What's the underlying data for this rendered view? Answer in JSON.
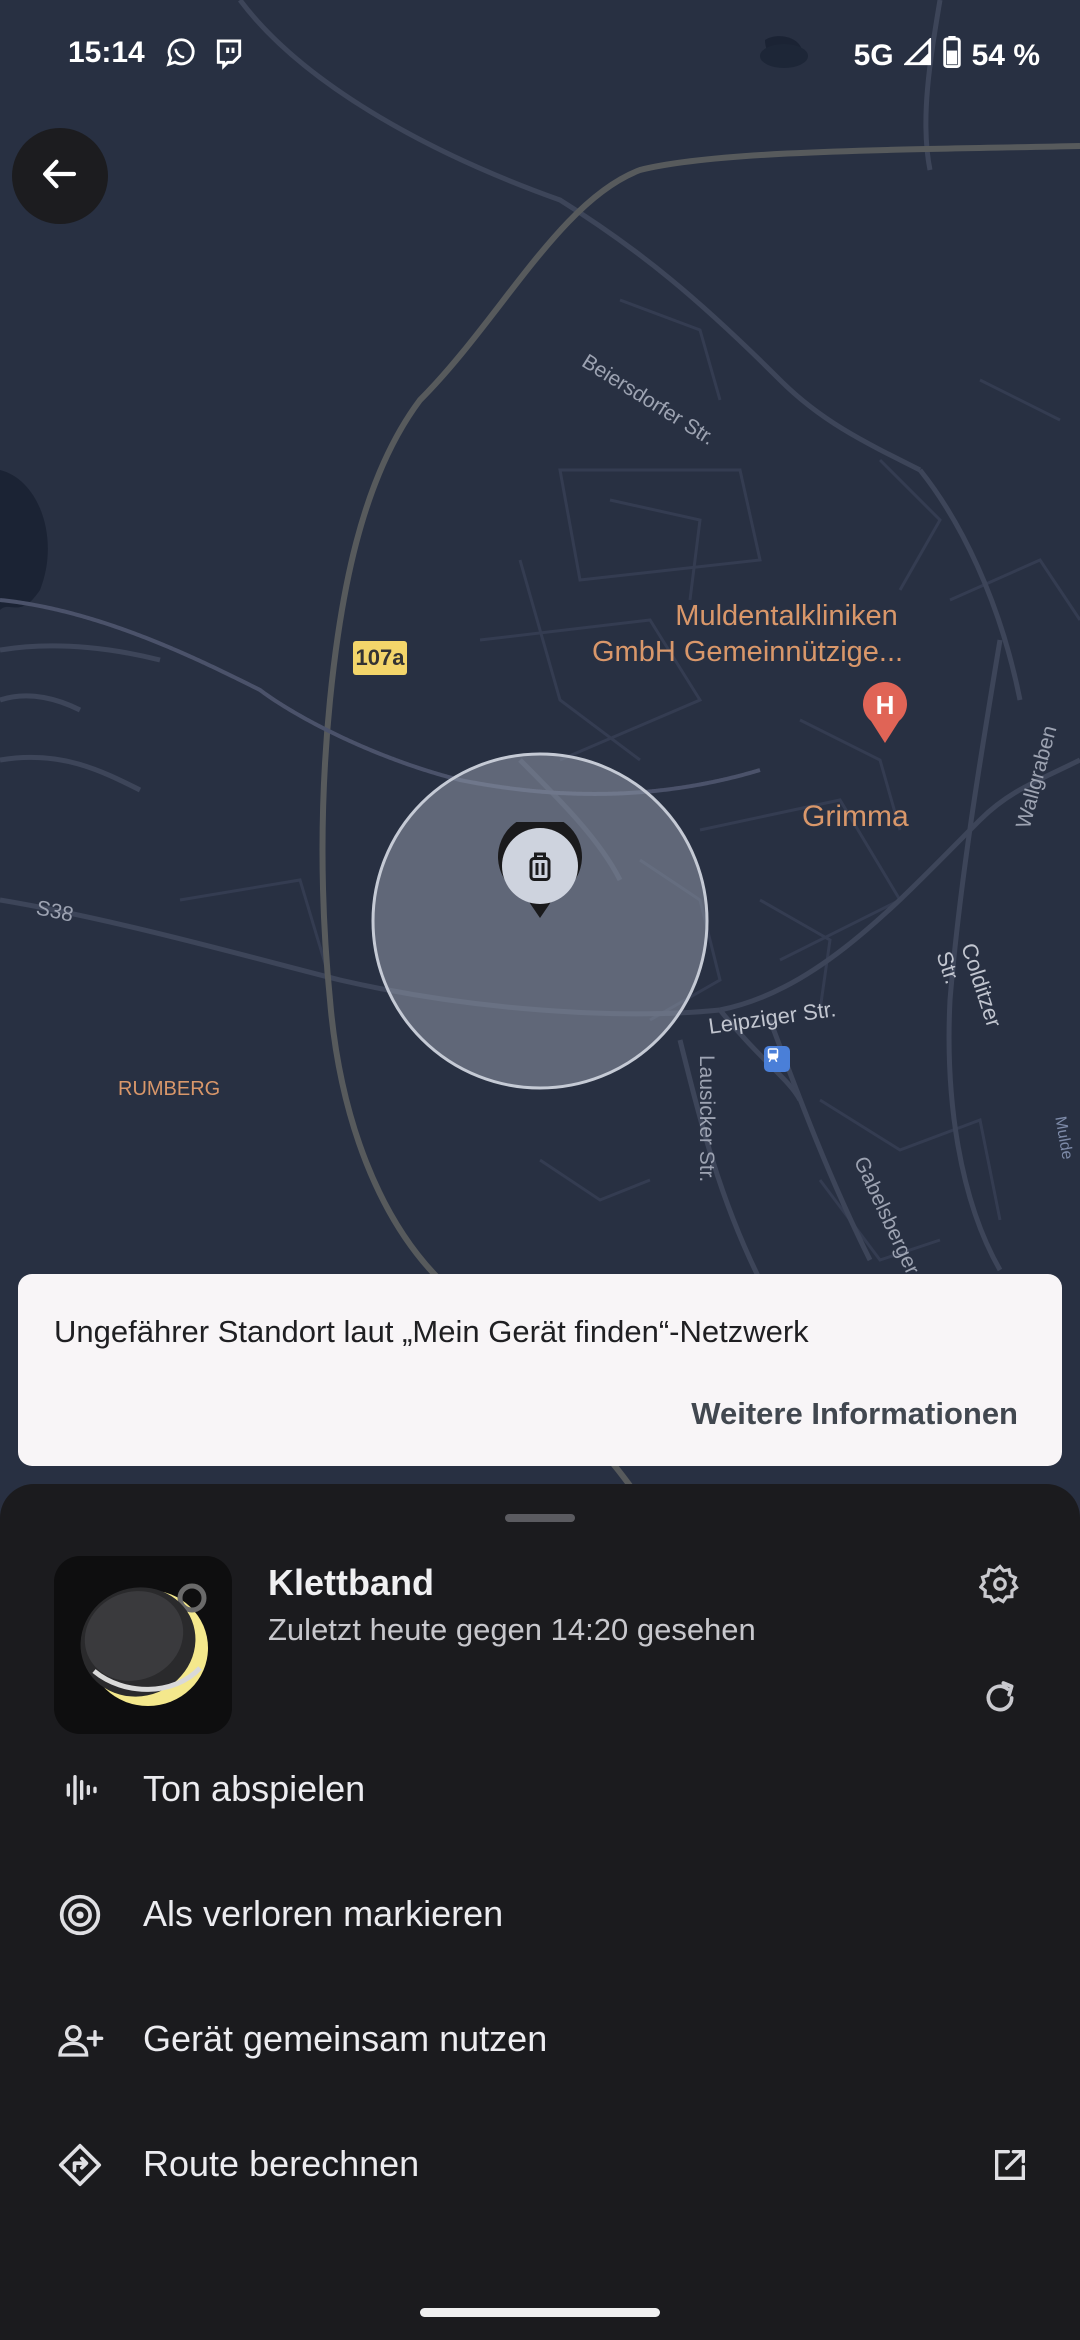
{
  "status_bar": {
    "time": "15:14",
    "network": "5G",
    "battery": "54 %",
    "icons": [
      "whatsapp-icon",
      "twitch-icon",
      "cellular-signal-icon",
      "battery-icon"
    ]
  },
  "map": {
    "labels": {
      "road_107a": "107a",
      "beiersdorfer": "Beiersdorfer Str.",
      "hospital_line1": "Muldentalkliniken",
      "hospital_line2": "GmbH Gemeinnützige...",
      "hospital_marker": "H",
      "grimma": "Grimma",
      "wallgraben": "Wallgraben",
      "s38": "S38",
      "leipziger": "Leipziger Str.",
      "colditzer": "Colditzer Str.",
      "rumberg": "RUMBERG",
      "lausicker": "Lausicker Str.",
      "gabelsberger": "Gabelsberger S",
      "mulde": "Mulde"
    },
    "colors": {
      "background": "#283042",
      "road": "#3b4358",
      "major_road": "#56595b",
      "poi_text": "#d9976a",
      "hospital": "#e06456"
    }
  },
  "info_card": {
    "text": "Ungefährer Standort laut „Mein Gerät finden“-Netzwerk",
    "link": "Weitere Informationen"
  },
  "device": {
    "name": "Klettband",
    "last_seen": "Zuletzt heute gegen 14:20 gesehen"
  },
  "actions": [
    {
      "label": "Ton abspielen",
      "icon": "sound-wave-icon"
    },
    {
      "label": "Als verloren markieren",
      "icon": "lost-target-icon"
    },
    {
      "label": "Gerät gemeinsam nutzen",
      "icon": "person-add-icon"
    },
    {
      "label": "Route berechnen",
      "icon": "directions-icon"
    }
  ]
}
